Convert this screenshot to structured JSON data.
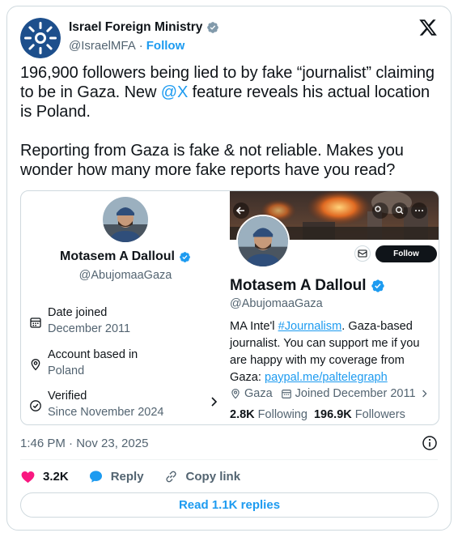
{
  "author": {
    "name": "Israel Foreign Ministry",
    "handle": "@IsraelMFA",
    "separator": "·",
    "follow_label": "Follow",
    "verified_badge_color": "#829aab"
  },
  "tweet": {
    "text_part1": "196,900 followers being lied to by fake “journalist” claiming to be in Gaza. New ",
    "mention": "@X",
    "text_part2": " feature reveals his actual location is Poland.\n\nReporting from Gaza is fake & not reliable. Makes you wonder how many more fake reports have you read?"
  },
  "media": {
    "about_panel": {
      "name": "Motasem A Dalloul",
      "handle": "@AbujomaaGaza",
      "rows": [
        {
          "icon": "calendar-icon",
          "label": "Date joined",
          "value": "December 2011"
        },
        {
          "icon": "location-icon",
          "label": "Account based in",
          "value": "Poland"
        },
        {
          "icon": "verified-check-icon",
          "label": "Verified",
          "value": "Since November 2024"
        }
      ]
    },
    "profile_panel": {
      "name": "Motasem A Dalloul",
      "handle": "@AbujomaaGaza",
      "follow_label": "Follow",
      "bio_part1": "MA Inte'l ",
      "bio_hashtag": "#Journalism",
      "bio_part2": ". Gaza-based journalist. You can support me if you are happy with my coverage from Gaza: ",
      "bio_link": "paypal.me/paltelegraph",
      "location": "Gaza",
      "joined": "Joined December 2011",
      "following_count": "2.8K",
      "following_label": "Following",
      "followers_count": "196.9K",
      "followers_label": "Followers"
    }
  },
  "timestamp": "1:46 PM · Nov 23, 2025",
  "actions": {
    "like_count": "3.2K",
    "reply_label": "Reply",
    "copy_label": "Copy link",
    "read_replies_label": "Read 1.1K replies"
  },
  "colors": {
    "accent": "#1d9bf0",
    "like": "#f91880",
    "text": "#0f1419",
    "secondary": "#536471"
  }
}
